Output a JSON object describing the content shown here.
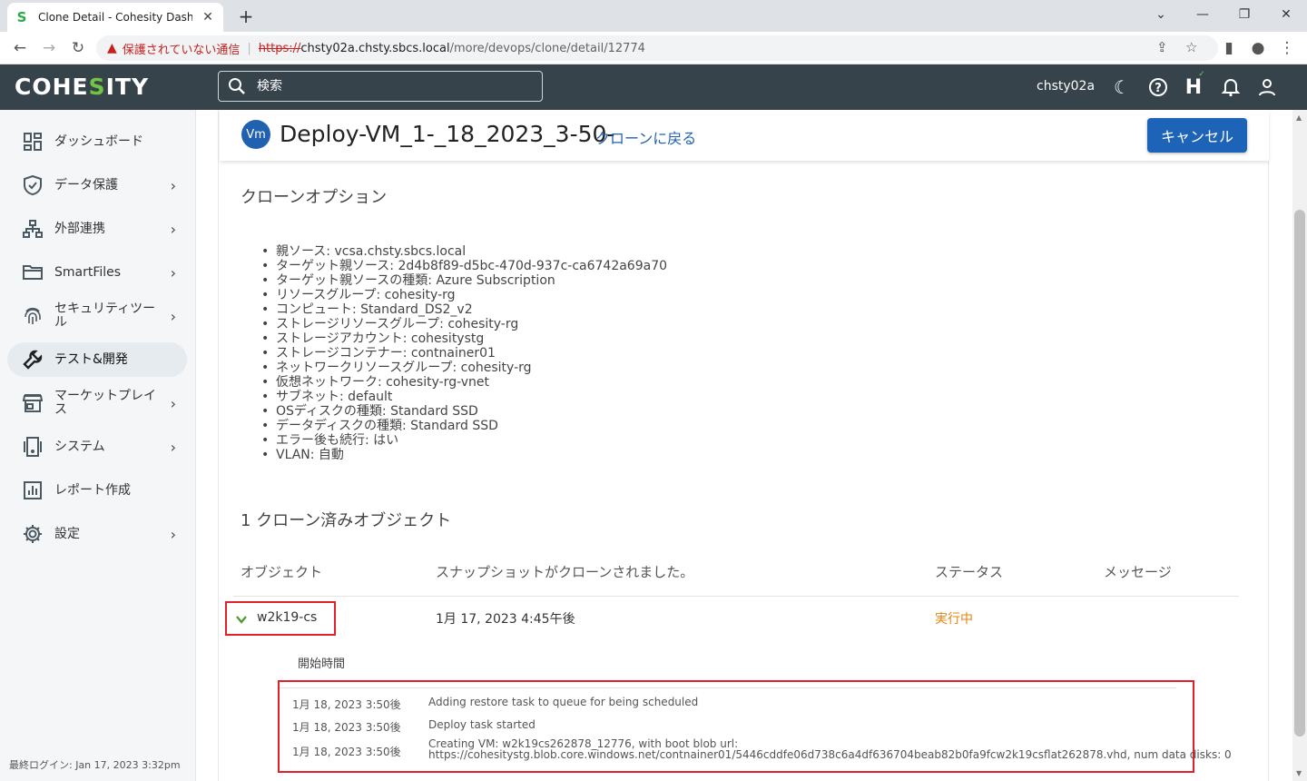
{
  "browser": {
    "tab_title": "Clone Detail - Cohesity Dashboard",
    "insecure_label": "保護されていない通信",
    "url_scheme": "https://",
    "url_host": "chsty02a.chsty.sbcs.local",
    "url_path": "/more/devops/clone/detail/12774"
  },
  "app": {
    "logo_a": "COHE",
    "logo_b": "S",
    "logo_c": "ITY",
    "search_placeholder": "検索",
    "username": "chsty02a"
  },
  "sidebar": {
    "items": [
      {
        "label": "ダッシュボード",
        "icon": "dashboard-icon",
        "arrow": ""
      },
      {
        "label": "データ保護",
        "icon": "shield-icon",
        "arrow": "›"
      },
      {
        "label": "外部連携",
        "icon": "hierarchy-icon",
        "arrow": "›"
      },
      {
        "label": "SmartFiles",
        "icon": "folder-icon",
        "arrow": "›"
      },
      {
        "label": "セキュリティツール",
        "icon": "fingerprint-icon",
        "arrow": "›"
      },
      {
        "label": "テスト&開発",
        "icon": "wrench-icon",
        "arrow": ""
      },
      {
        "label": "マーケットプレイス",
        "icon": "store-icon",
        "arrow": "›"
      },
      {
        "label": "システム",
        "icon": "server-icon",
        "arrow": "›"
      },
      {
        "label": "レポート作成",
        "icon": "report-icon",
        "arrow": ""
      },
      {
        "label": "設定",
        "icon": "gear-icon",
        "arrow": "›"
      }
    ],
    "last_login": "最終ログイン: Jan 17, 2023 3:32pm"
  },
  "header": {
    "badge": "Vm",
    "title": "Deploy-VM_1-_18_2023_3-50-",
    "back_link": "クローンに戻る",
    "cancel": "キャンセル"
  },
  "clone_options": {
    "title": "クローンオプション",
    "items": [
      "親ソース: vcsa.chsty.sbcs.local",
      "ターゲット親ソース: 2d4b8f89-d5bc-470d-937c-ca6742a69a70",
      "ターゲット親ソースの種類: Azure Subscription",
      "リソースグループ: cohesity-rg",
      "コンピュート: Standard_DS2_v2",
      "ストレージリソースグループ: cohesity-rg",
      "ストレージアカウント: cohesitystg",
      "ストレージコンテナー: contnainer01",
      "ネットワークリソースグループ: cohesity-rg",
      "仮想ネットワーク: cohesity-rg-vnet",
      "サブネット: default",
      "OSディスクの種類: Standard SSD",
      "データディスクの種類: Standard SSD",
      "エラー後も続行: はい",
      "VLAN: 自動"
    ]
  },
  "objects": {
    "title": "1 クローン済みオブジェクト",
    "columns": [
      "オブジェクト",
      "スナップショットがクローンされました。",
      "ステータス",
      "メッセージ"
    ],
    "row": {
      "name": "w2k19-cs",
      "snapshot": "1月 17, 2023 4:45午後",
      "status": "実行中"
    },
    "start_time_label": "開始時間",
    "events": [
      {
        "time": "1月 18, 2023 3:50後",
        "msg": "Adding restore task to queue for being scheduled"
      },
      {
        "time": "1月 18, 2023 3:50後",
        "msg": "Deploy task started"
      },
      {
        "time": "1月 18, 2023 3:50後",
        "msg": "Creating VM: w2k19cs262878_12776, with boot blob url:",
        "msg2": "https://cohesitystg.blob.core.windows.net/contnainer01/5446cddfe06d738c6a4df636704beab82b0fa9fcw2k19csflat262878.vhd, num data disks: 0"
      }
    ]
  }
}
